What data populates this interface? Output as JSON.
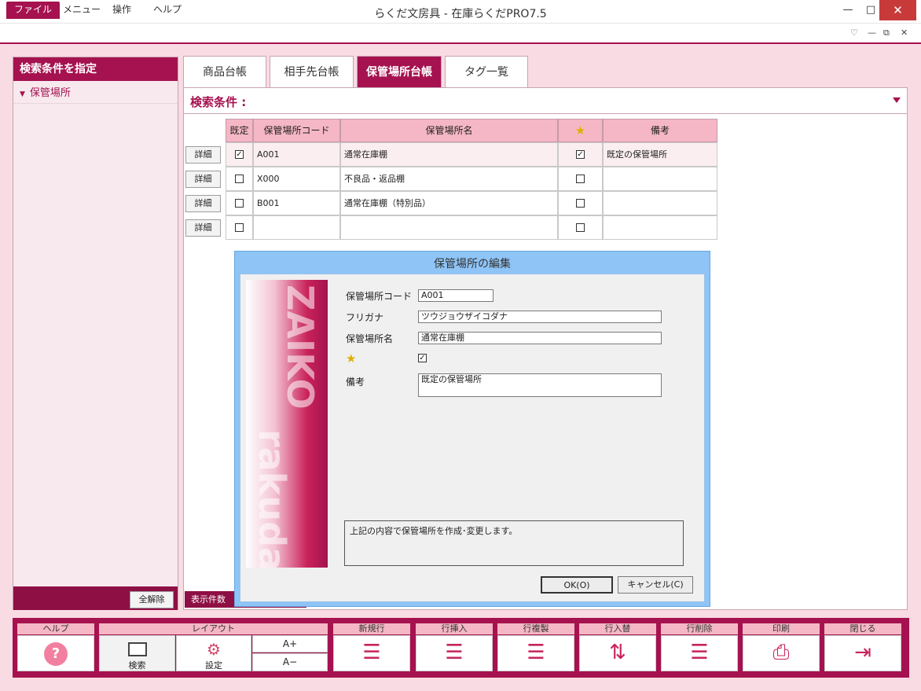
{
  "window": {
    "title": "らくだ文房具 - 在庫らくだPRO7.5",
    "minimize": "—",
    "maximize": "□",
    "close": "✕"
  },
  "menu": {
    "items": [
      "ファイル",
      "メニュー",
      "操作",
      "ヘルプ"
    ]
  },
  "left": {
    "header": "検索条件を指定",
    "item": "保管場所",
    "clear_button": "全解除"
  },
  "tabs": [
    "商品台帳",
    "相手先台帳",
    "保管場所台帳",
    "タグ一覧"
  ],
  "search": {
    "label": "検索条件 :"
  },
  "grid": {
    "headers": [
      "既定",
      "保管場所コード",
      "保管場所名",
      "★",
      "備考"
    ],
    "detail_label": "詳細",
    "rows": [
      {
        "default": true,
        "code": "A001",
        "name": "通常在庫棚",
        "star": true,
        "note": "既定の保管場所"
      },
      {
        "default": false,
        "code": "X000",
        "name": "不良品・返品棚",
        "star": false,
        "note": ""
      },
      {
        "default": false,
        "code": "B001",
        "name": "通常在庫棚（特別品）",
        "star": false,
        "note": ""
      },
      {
        "default": false,
        "code": "",
        "name": "",
        "star": false,
        "note": ""
      }
    ]
  },
  "status": {
    "count_label": "表示件数"
  },
  "dialog": {
    "title": "保管場所の編集",
    "brand_top": "ZAIKO",
    "brand_bottom": "rakuda",
    "fields": {
      "code_label": "保管場所コード",
      "code_value": "A001",
      "kana_label": "フリガナ",
      "kana_value": "ツウジョウザイコダナ",
      "name_label": "保管場所名",
      "name_value": "通常在庫棚",
      "star_checked": true,
      "note_label": "備考",
      "note_value": "既定の保管場所"
    },
    "message": "上記の内容で保管場所を作成･変更します。",
    "ok": "OK(O)",
    "cancel": "キャンセル(C)"
  },
  "toolbar": {
    "help": {
      "header": "ヘルプ"
    },
    "layout": {
      "header": "レイアウト",
      "search": "検索",
      "settings": "設定",
      "font_up": "A+",
      "font_down": "A−"
    },
    "new_row": "新規行",
    "insert_row": "行挿入",
    "copy_row": "行複製",
    "swap_row": "行入替",
    "delete_row": "行削除",
    "print": "印刷",
    "close": "閉じる"
  }
}
